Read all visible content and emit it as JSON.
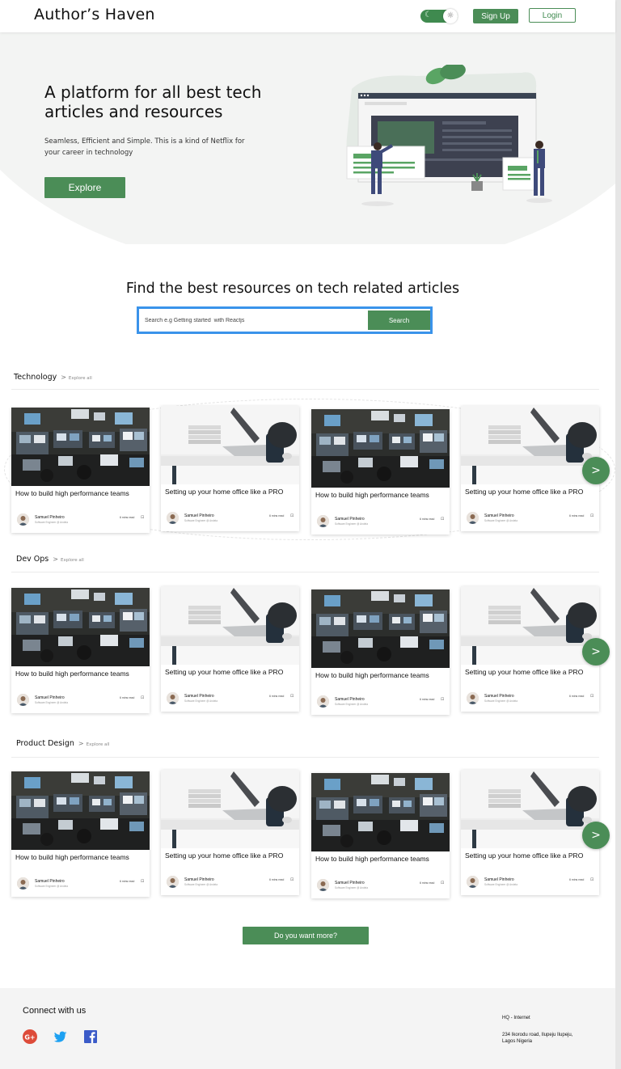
{
  "nav": {
    "brand": "Author’s Haven",
    "signup_label": "Sign Up",
    "login_label": "Login",
    "theme_toggle": {
      "state": "light",
      "icons": [
        "moon-icon",
        "sun-icon"
      ]
    }
  },
  "hero": {
    "title": "A platform for all best tech articles and resources",
    "subtitle": "Seamless, Efficient and Simple. This is a kind of Netflix for your career in technology",
    "explore_label": "Explore"
  },
  "search": {
    "heading": "Find the best resources on tech related  articles",
    "placeholder": "Search e.g Getting started  with Reactjs",
    "button_label": "Search"
  },
  "sections": [
    {
      "title": "Technology",
      "explore_label": "Explore all",
      "cards": [
        {
          "title": "How  to build high performance teams",
          "author": "Samuel Pinheiro",
          "role": "Software Engineer @ Andela",
          "read_time": "6 mins read",
          "image": "control-room"
        },
        {
          "title": "Setting up your home office like a PRO",
          "author": "Samuel Pinheiro",
          "role": "Software Engineer @ Andela",
          "read_time": "6 mins read",
          "image": "home-office"
        },
        {
          "title": "How  to build high performance teams",
          "author": "Samuel Pinheiro",
          "role": "Software Engineer @ Andela",
          "read_time": "6 mins read",
          "image": "control-room"
        },
        {
          "title": "Setting up your home office like a PRO",
          "author": "Samuel Pinheiro",
          "role": "Software Engineer @ Andela",
          "read_time": "6 mins read",
          "image": "home-office"
        }
      ],
      "next_label": ">"
    },
    {
      "title": "Dev Ops",
      "explore_label": "Explore all",
      "cards": [
        {
          "title": "How  to build high performance teams",
          "author": "Samuel Pinheiro",
          "role": "Software Engineer @ Andela",
          "read_time": "6 mins read",
          "image": "control-room"
        },
        {
          "title": "Setting up your home office like a PRO",
          "author": "Samuel Pinheiro",
          "role": "Software Engineer @ Andela",
          "read_time": "6 mins read",
          "image": "home-office"
        },
        {
          "title": "How  to build high performance teams",
          "author": "Samuel Pinheiro",
          "role": "Software Engineer @ Andela",
          "read_time": "6 mins read",
          "image": "control-room"
        },
        {
          "title": "Setting up your home office like a PRO",
          "author": "Samuel Pinheiro",
          "role": "Software Engineer @ Andela",
          "read_time": "6 mins read",
          "image": "home-office"
        }
      ],
      "next_label": ">"
    },
    {
      "title": "Product Design",
      "explore_label": "Explore all",
      "cards": [
        {
          "title": "How  to build high performance teams",
          "author": "Samuel Pinheiro",
          "role": "Software Engineer @ Andela",
          "read_time": "6 mins read",
          "image": "control-room"
        },
        {
          "title": "Setting up your home office like a PRO",
          "author": "Samuel Pinheiro",
          "role": "Software Engineer @ Andela",
          "read_time": "6 mins read",
          "image": "home-office"
        },
        {
          "title": "How  to build high performance teams",
          "author": "Samuel Pinheiro",
          "role": "Software Engineer @ Andela",
          "read_time": "6 mins read",
          "image": "control-room"
        },
        {
          "title": "Setting up your home office like a PRO",
          "author": "Samuel Pinheiro",
          "role": "Software Engineer @ Andela",
          "read_time": "6 mins read",
          "image": "home-office"
        }
      ],
      "next_label": ">"
    }
  ],
  "more_label": "Do you want more?",
  "footer": {
    "connect_label": "Connect with us",
    "social_icons": [
      "google-plus-icon",
      "twitter-icon",
      "facebook-icon"
    ],
    "hq_label": "HQ - Internet",
    "address": "234 Ikorodu road, Ilupeju Ilupeju, Lagos Nigeria"
  },
  "colors": {
    "brand_green": "#4b8d57",
    "search_border": "#3a93ea",
    "hero_bg": "#f3f4f3",
    "footer_bg": "#f4f4f4"
  }
}
